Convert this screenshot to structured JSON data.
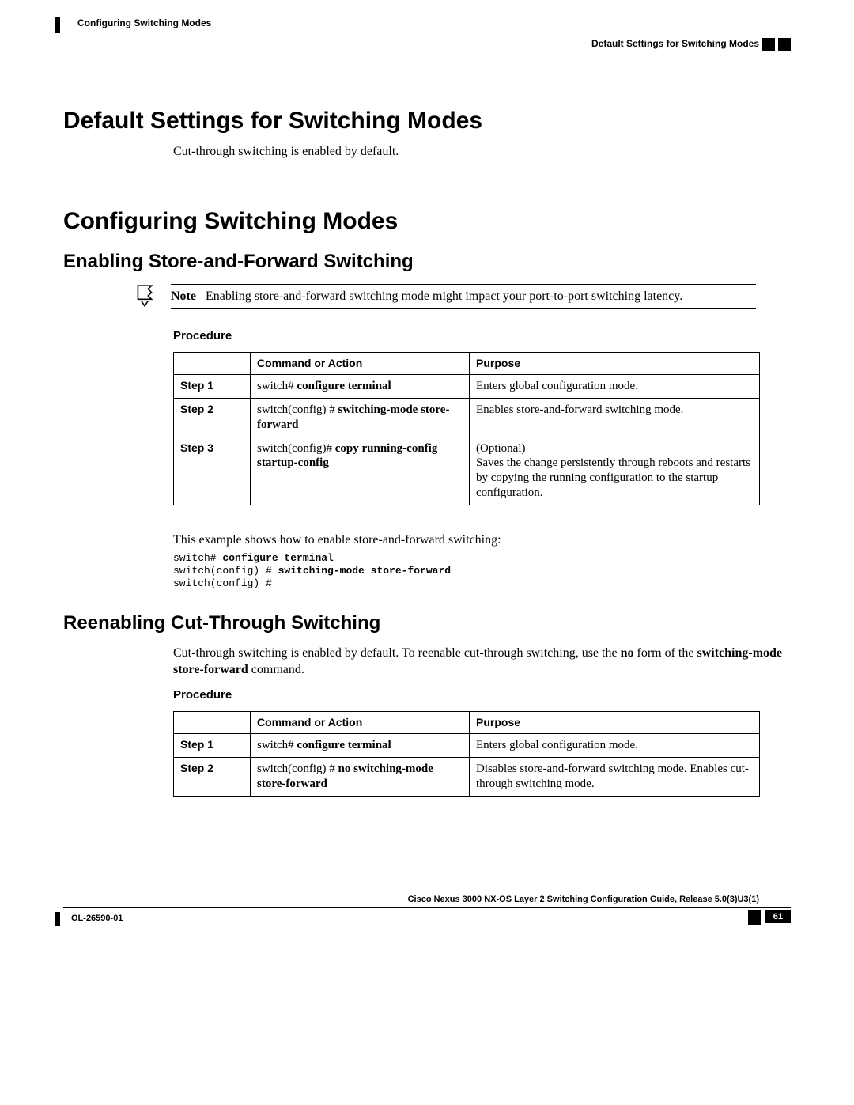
{
  "header": {
    "chapter": "Configuring Switching Modes",
    "section_ref": "Default Settings for Switching Modes"
  },
  "h1_defaults": "Default Settings for Switching Modes",
  "defaults_body": "Cut-through switching is enabled by default.",
  "h1_config": "Configuring Switching Modes",
  "h2_enable": "Enabling Store-and-Forward Switching",
  "note": {
    "label": "Note",
    "text": "Enabling store-and-forward switching mode might impact your port-to-port switching latency."
  },
  "procedure_label": "Procedure",
  "table1": {
    "headers": {
      "step": "",
      "cmd": "Command or Action",
      "purpose": "Purpose"
    },
    "rows": [
      {
        "step": "Step 1",
        "cmd_prefix": "switch# ",
        "cmd_bold": "configure terminal",
        "cmd_suffix": "",
        "purpose": "Enters global configuration mode."
      },
      {
        "step": "Step 2",
        "cmd_prefix": "switch(config) # ",
        "cmd_bold": "switching-mode store-forward",
        "cmd_suffix": "",
        "purpose": "Enables store-and-forward switching mode."
      },
      {
        "step": "Step 3",
        "cmd_prefix": "switch(config)# ",
        "cmd_bold": "copy running-config startup-config",
        "cmd_suffix": "",
        "purpose": "(Optional)\nSaves the change persistently through reboots and restarts by copying the running configuration to the startup configuration."
      }
    ]
  },
  "example_intro": "This example shows how to enable store-and-forward switching:",
  "example": {
    "l1p": "switch# ",
    "l1b": "configure terminal",
    "l2p": "switch(config) # ",
    "l2b": "switching-mode store-forward",
    "l3p": "switch(config) #"
  },
  "h2_reenable": "Reenabling Cut-Through Switching",
  "reenable_body_1": "Cut-through switching is enabled by default. To reenable cut-through switching, use the ",
  "reenable_body_bold1": "no",
  "reenable_body_2": " form of the ",
  "reenable_body_bold2": "switching-mode store-forward",
  "reenable_body_3": " command.",
  "table2": {
    "headers": {
      "step": "",
      "cmd": "Command or Action",
      "purpose": "Purpose"
    },
    "rows": [
      {
        "step": "Step 1",
        "cmd_prefix": "switch# ",
        "cmd_bold": "configure terminal",
        "cmd_suffix": "",
        "purpose": "Enters global configuration mode."
      },
      {
        "step": "Step 2",
        "cmd_prefix": "switch(config) # ",
        "cmd_bold": "no switching-mode store-forward",
        "cmd_suffix": "",
        "purpose": "Disables store-and-forward switching mode. Enables cut-through switching mode."
      }
    ]
  },
  "footer": {
    "doc_title": "Cisco Nexus 3000 NX-OS Layer 2 Switching Configuration Guide, Release 5.0(3)U3(1)",
    "ol": "OL-26590-01",
    "page": "61"
  }
}
